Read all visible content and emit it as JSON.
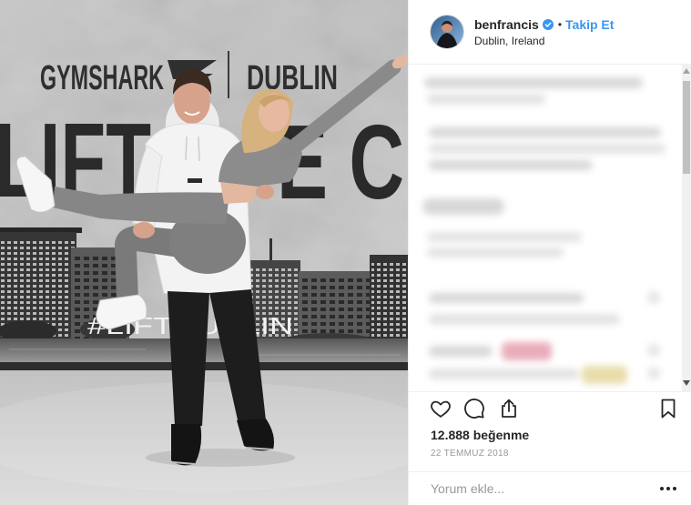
{
  "post_image": {
    "wall_brand": "GYMSHARK",
    "wall_city": "DUBLIN",
    "wall_slogan_left": "LIFT",
    "wall_slogan_right": "E C",
    "wall_hashtag": "#LIFTDUBLIN"
  },
  "header": {
    "username": "benfrancis",
    "verified": true,
    "separator": "•",
    "follow_label": "Takip Et",
    "location": "Dublin, Ireland"
  },
  "actions": {
    "like_icon": "heart-icon",
    "comment_icon": "comment-icon",
    "share_icon": "share-icon",
    "save_icon": "bookmark-icon"
  },
  "likes": "12.888 beğenme",
  "date": "22 TEMMUZ 2018",
  "comment_box": {
    "placeholder": "Yorum ekle...",
    "value": "",
    "more_icon": "more-options-icon"
  },
  "colors": {
    "accent": "#3897f0",
    "text": "#262626",
    "muted": "#999999",
    "border": "#efefef"
  }
}
